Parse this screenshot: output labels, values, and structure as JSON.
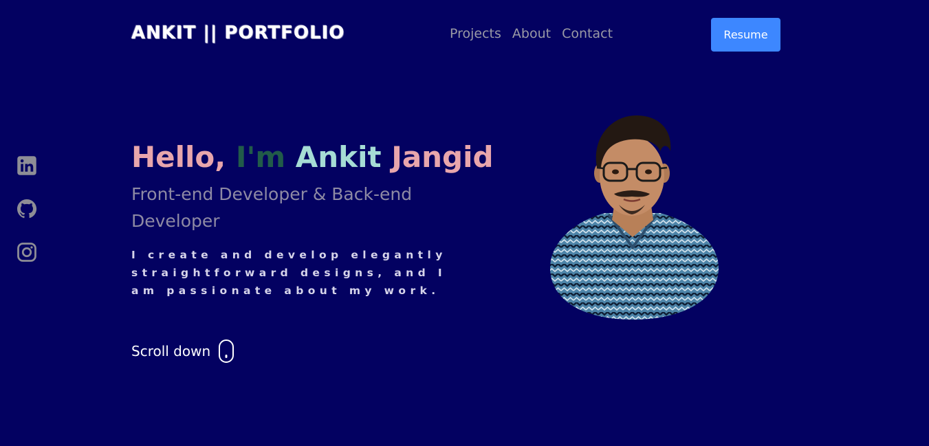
{
  "header": {
    "logo": "ANKIT || PORTFOLIO",
    "nav": [
      "Projects",
      "About",
      "Contact"
    ],
    "resume_label": "Resume"
  },
  "social": {
    "icons": [
      "linkedin-icon",
      "github-icon",
      "instagram-icon"
    ]
  },
  "hero": {
    "hello": "Hello,",
    "im": "I'm",
    "first": "Ankit",
    "last": "Jangid",
    "role": "Front-end Developer & Back-end Developer",
    "description": "I create and develop elegantly straightforward designs, and I am passionate about my work.",
    "scroll_label": "Scroll down"
  },
  "colors": {
    "background": "#030161",
    "accent_button": "#3d87ff",
    "pink": "#e8a6ac",
    "green": "#215b49",
    "mint": "#a6dcd5",
    "muted_text": "#9a9aa5"
  }
}
